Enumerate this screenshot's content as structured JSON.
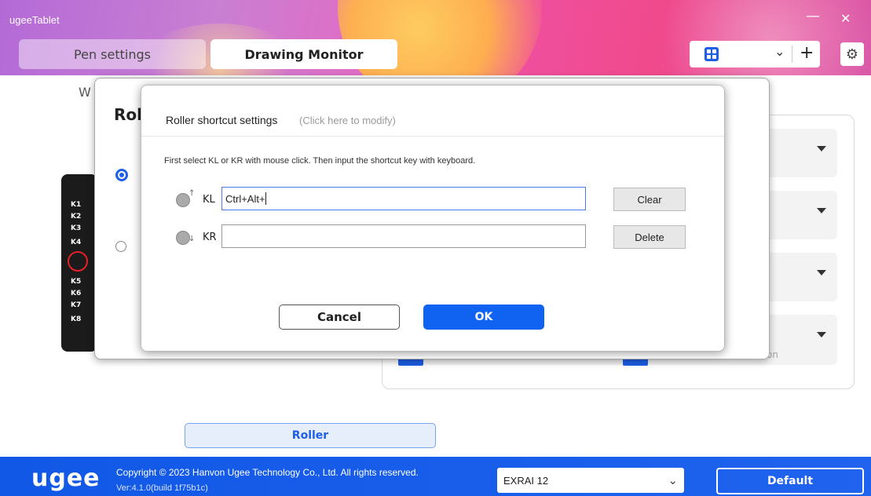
{
  "app": {
    "title": "ugeeTablet",
    "minimize_glyph": "—",
    "close_glyph": "✕"
  },
  "tabs": [
    {
      "label": "Pen settings",
      "active": false
    },
    {
      "label": "Drawing Monitor",
      "active": true
    }
  ],
  "toolbar": {
    "profile_icon": "grid-icon",
    "dropdown_glyph": "⌄",
    "add_glyph": "+",
    "settings_icon": "gear-icon",
    "settings_glyph": "⚙"
  },
  "background": {
    "partial_label": "W",
    "roller_button": "Roller",
    "partial_text": "on"
  },
  "device_keys": {
    "top": [
      "K1",
      "K2",
      "K3",
      "K4"
    ],
    "bottom": [
      "K5",
      "K6",
      "K7",
      "K8"
    ]
  },
  "back_dialog": {
    "title_partial": "Rol"
  },
  "dialog": {
    "title": "Roller shortcut settings",
    "hint": "(Click here to modify)",
    "instruction": "First select KL or KR with mouse click. Then input the shortcut key with keyboard.",
    "rows": [
      {
        "label": "KL",
        "value": "Ctrl+Alt+",
        "action": "Clear",
        "focused": true
      },
      {
        "label": "KR",
        "value": "",
        "action": "Delete",
        "focused": false
      }
    ],
    "cancel_label": "Cancel",
    "ok_label": "OK"
  },
  "footer": {
    "logo": "ugee",
    "copyright": "Copyright © 2023 Hanvon Ugee Technology Co., Ltd. All rights reserved.",
    "version": "Ver:4.1.0(build 1f75b1c)",
    "device_selected": "EXRAI 12",
    "default_label": "Default"
  },
  "colors": {
    "accent": "#1e5fe8",
    "ok": "#1063f0",
    "ring": "#e8202a"
  }
}
